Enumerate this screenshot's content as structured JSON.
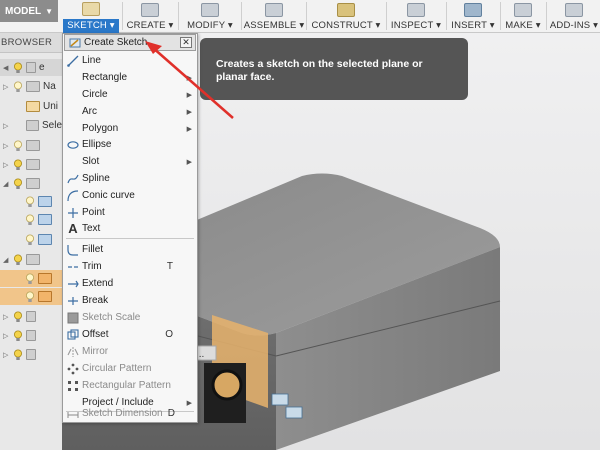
{
  "toolbar": {
    "model_label": "MODEL",
    "groups": [
      {
        "label": "SKETCH ▾"
      },
      {
        "label": "CREATE ▾"
      },
      {
        "label": "MODIFY ▾"
      },
      {
        "label": "ASSEMBLE ▾"
      },
      {
        "label": "CONSTRUCT ▾"
      },
      {
        "label": "INSPECT ▾"
      },
      {
        "label": "INSERT ▾"
      },
      {
        "label": "MAKE ▾"
      },
      {
        "label": "ADD-INS ▾"
      }
    ]
  },
  "browser": {
    "title": "BROWSER",
    "rows": [
      {
        "label": "e"
      },
      {
        "label": "Na"
      },
      {
        "label": "Uni"
      },
      {
        "label": "Sele"
      }
    ]
  },
  "tooltip": {
    "text": "Creates a sketch on the selected plane or planar face."
  },
  "menu": {
    "items": [
      {
        "label": "Create Sketch",
        "close": "✕"
      },
      {
        "label": "Line"
      },
      {
        "label": "Rectangle"
      },
      {
        "label": "Circle"
      },
      {
        "label": "Arc"
      },
      {
        "label": "Polygon"
      },
      {
        "label": "Ellipse"
      },
      {
        "label": "Slot"
      },
      {
        "label": "Spline"
      },
      {
        "label": "Conic curve"
      },
      {
        "label": "Point"
      },
      {
        "label": "Text"
      },
      {
        "label": "Fillet"
      },
      {
        "label": "Trim",
        "key": "T"
      },
      {
        "label": "Extend"
      },
      {
        "label": "Break"
      },
      {
        "label": "Sketch Scale"
      },
      {
        "label": "Offset",
        "key": "O"
      },
      {
        "label": "Mirror"
      },
      {
        "label": "Circular Pattern"
      },
      {
        "label": "Rectangular Pattern"
      },
      {
        "label": "Project / Include"
      },
      {
        "label": "Sketch Dimension",
        "key": "D"
      }
    ]
  },
  "viewport": {
    "ellipsis": "..."
  },
  "colors": {
    "accent": "#2a78c9",
    "arrow": "#e0302a",
    "selection": "#f1c58a",
    "tooltip_bg": "#555555"
  }
}
